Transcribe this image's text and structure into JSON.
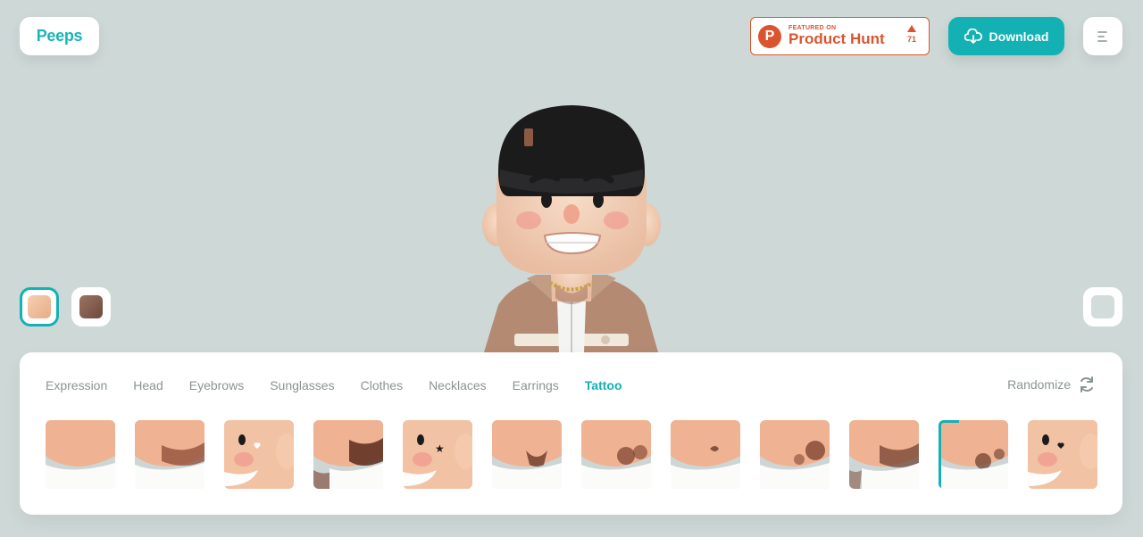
{
  "header": {
    "logo": "Peeps",
    "product_hunt": {
      "featured": "FEATURED ON",
      "name": "Product Hunt",
      "votes": "71",
      "letter": "P"
    },
    "download_label": "Download"
  },
  "skin_tones": [
    {
      "color": "#f0c3a3",
      "selected": true
    },
    {
      "color": "#8a6453",
      "selected": false
    }
  ],
  "tabs": [
    {
      "label": "Expression"
    },
    {
      "label": "Head"
    },
    {
      "label": "Eyebrows"
    },
    {
      "label": "Sunglasses"
    },
    {
      "label": "Clothes"
    },
    {
      "label": "Necklaces"
    },
    {
      "label": "Earrings"
    },
    {
      "label": "Tattoo",
      "active": true
    }
  ],
  "randomize_label": "Randomize",
  "tattoo_options": [
    {
      "kind": "neck-plain"
    },
    {
      "kind": "neck-ornate"
    },
    {
      "kind": "face-heart"
    },
    {
      "kind": "neck-dense"
    },
    {
      "kind": "face-star"
    },
    {
      "kind": "neck-eagle"
    },
    {
      "kind": "neck-mandala"
    },
    {
      "kind": "neck-small"
    },
    {
      "kind": "neck-floral"
    },
    {
      "kind": "neck-roses"
    },
    {
      "kind": "neck-flower",
      "selected": true
    },
    {
      "kind": "face-black-heart"
    }
  ],
  "colors": {
    "accent": "#13b1b3",
    "background": "#ced8d7",
    "producthunt": "#da552f"
  }
}
